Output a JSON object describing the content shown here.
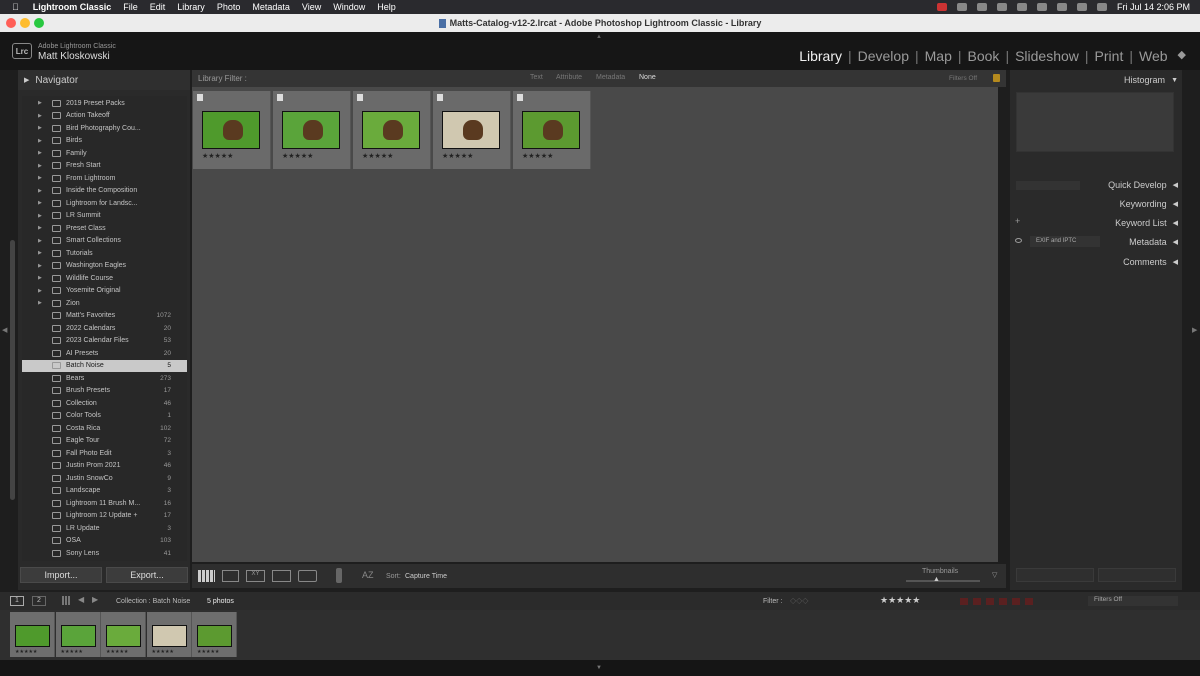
{
  "menubar": {
    "app": "Lightroom Classic",
    "items": [
      "File",
      "Edit",
      "Library",
      "Photo",
      "Metadata",
      "View",
      "Window",
      "Help"
    ],
    "clock": "Fri Jul 14  2:06 PM"
  },
  "window": {
    "title": "Matts-Catalog-v12-2.lrcat - Adobe Photoshop Lightroom Classic - Library"
  },
  "identity": {
    "logo": "Lrc",
    "product": "Adobe Lightroom Classic",
    "owner": "Matt Kloskowski"
  },
  "modules": {
    "items": [
      "Library",
      "Develop",
      "Map",
      "Book",
      "Slideshow",
      "Print",
      "Web"
    ],
    "active": "Library"
  },
  "left": {
    "navigator": "Navigator",
    "folders": [
      "2019 Preset Packs",
      "Action Takeoff",
      "Bird Photography Cou...",
      "Birds",
      "Family",
      "Fresh Start",
      "From Lightroom",
      "Inside the Composition",
      "Lightroom for Landsc...",
      "LR Summit",
      "Preset Class",
      "Smart Collections",
      "Tutorials",
      "Washington Eagles",
      "Wildlife Course",
      "Yosemite Original",
      "Zion"
    ],
    "collections": [
      {
        "name": "Matt's Favorites",
        "count": "1072"
      },
      {
        "name": "2022 Calendars",
        "count": "20"
      },
      {
        "name": "2023 Calendar Files",
        "count": "53"
      },
      {
        "name": "AI Presets",
        "count": "20"
      },
      {
        "name": "Batch Noise",
        "count": "5"
      },
      {
        "name": "Bears",
        "count": "273"
      },
      {
        "name": "Brush Presets",
        "count": "17"
      },
      {
        "name": "Collection",
        "count": "46"
      },
      {
        "name": "Color Tools",
        "count": "1"
      },
      {
        "name": "Costa Rica",
        "count": "102"
      },
      {
        "name": "Eagle Tour",
        "count": "72"
      },
      {
        "name": "Fall Photo Edit",
        "count": "3"
      },
      {
        "name": "Justin Prom 2021",
        "count": "46"
      },
      {
        "name": "Justin SnowCo",
        "count": "9"
      },
      {
        "name": "Landscape",
        "count": "3"
      },
      {
        "name": "Lightroom 11 Brush M...",
        "count": "16"
      },
      {
        "name": "Lightroom 12 Update +",
        "count": "17"
      },
      {
        "name": "LR Update",
        "count": "3"
      },
      {
        "name": "OSA",
        "count": "103"
      },
      {
        "name": "Sony Lens",
        "count": "41"
      }
    ],
    "selected": "Batch Noise",
    "import": "Import...",
    "export": "Export..."
  },
  "filter": {
    "label": "Library Filter :",
    "options": [
      "Text",
      "Attribute",
      "Metadata",
      "None"
    ],
    "state": "Filters Off"
  },
  "grid": {
    "stars": "★★★★★",
    "count": 5
  },
  "toolbar": {
    "sort_label": "Sort:",
    "sort_value": "Capture Time",
    "thumbnails": "Thumbnails"
  },
  "right": {
    "histogram": "Histogram",
    "quick_develop": "Quick Develop",
    "keywording": "Keywording",
    "keyword_list": "Keyword List",
    "metadata": "Metadata",
    "metadata_preset": "EXIF and IPTC",
    "comments": "Comments"
  },
  "filmbar": {
    "page1": "1",
    "page2": "2",
    "collection": "Collection : Batch Noise",
    "photos": "5 photos",
    "filter_label": "Filter :",
    "stars": "★★★★★",
    "filters_off": "Filters Off"
  },
  "colors": {
    "accent_green": "#5aa028",
    "bear_brown": "#5a3a20",
    "selected_row": "#c9c9c9"
  }
}
